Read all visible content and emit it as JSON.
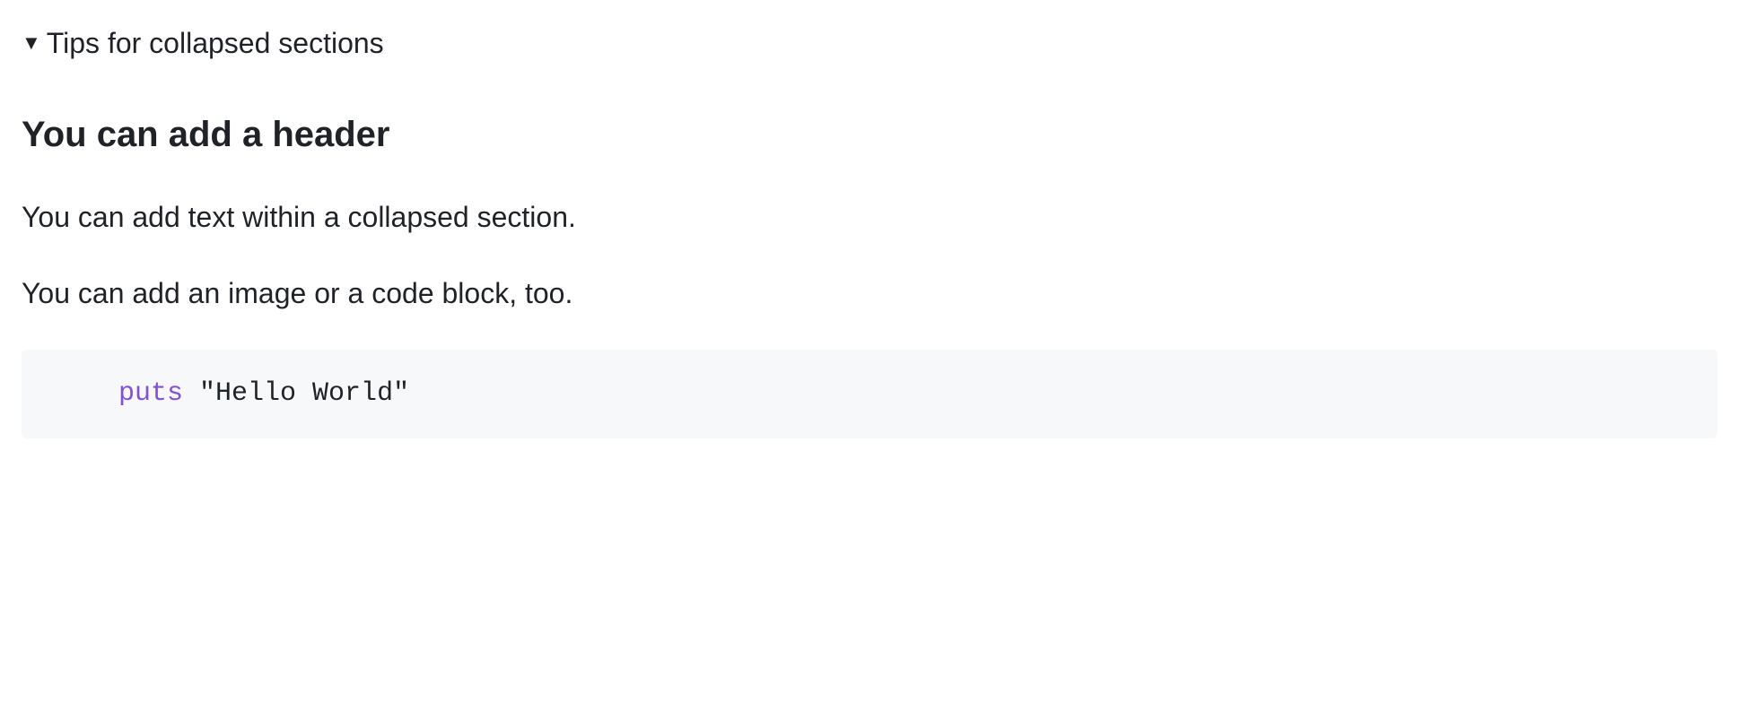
{
  "summary": {
    "label": "Tips for collapsed sections"
  },
  "content": {
    "header": "You can add a header",
    "paragraph1": "You can add text within a collapsed section.",
    "paragraph2": "You can add an image or a code block, too.",
    "code": {
      "keyword": "puts",
      "string": "\"Hello World\""
    }
  }
}
